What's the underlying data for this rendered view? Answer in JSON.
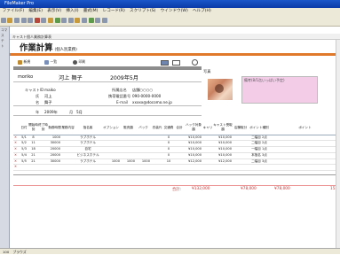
{
  "window": {
    "title": "FileMaker Pro"
  },
  "menu": [
    "ファイル(F)",
    "編集(E)",
    "表示(V)",
    "挿入(I)",
    "書式(M)",
    "レコード(R)",
    "スクリプト(S)",
    "ウインドウ(W)",
    "ヘルプ(H)"
  ],
  "sidebar": {
    "labels": [
      "コマ",
      "ス",
      "テ",
      "ト"
    ]
  },
  "breadcrumb": "キャスト個人業務計算表",
  "page": {
    "title": "作業計算",
    "subtitle": "(個人別業務)"
  },
  "nav": {
    "new": "新規",
    "list": "一覧",
    "print": "印刷"
  },
  "person": {
    "romaji": "moriko",
    "name": "河上 舞子",
    "period": "2009年5月"
  },
  "info": {
    "cast_label": "キャストID",
    "cast_value": "maiko",
    "owner_label": "所属店名",
    "owner_value": "店舗○○○○",
    "name_label": "氏",
    "name_value": "河上",
    "phone_label": "携帯電話番号",
    "phone_value": "090-0000-0000",
    "given_label": "名",
    "given_value": "舞子",
    "email_label": "E-mail",
    "email_value": "xxxxx@docomo.ne.jp",
    "year_label": "年",
    "year_value": "2009年",
    "month_label": "月",
    "month_value": "5月"
  },
  "photo_label": "写真",
  "memo": "備考(8/1迄いっぱい予定)",
  "table": {
    "headers": [
      "日付",
      "開始時刻",
      "終了時刻",
      "勤務時間",
      "業務内容",
      "指名客",
      "オプション",
      "販売額",
      "バック",
      "衣装代",
      "交通費",
      "合計",
      "ハック対象額",
      "キャリ",
      "キャスト受取額",
      "店舗取分",
      "ポイント種別",
      "ポイント"
    ],
    "rows": [
      [
        "5/1",
        "8",
        "",
        "1000",
        "",
        "ラブホテル",
        "",
        "",
        "",
        "",
        "0",
        "",
        "¥10,000",
        "",
        "¥10,000",
        "",
        "二幅目 2点",
        ""
      ],
      [
        "5/2",
        "11",
        "",
        "30000",
        "",
        "ラブホテル",
        "",
        "",
        "",
        "",
        "0",
        "",
        "¥10,000",
        "",
        "¥10,000",
        "",
        "二幅目 2点",
        ""
      ],
      [
        "5/3",
        "18",
        "",
        "20000",
        "",
        "自宅",
        "",
        "",
        "",
        "",
        "0",
        "",
        "¥10,000",
        "",
        "¥10,000",
        "",
        "一幅目 1点",
        ""
      ],
      [
        "5/4",
        "21",
        "",
        "20000",
        "",
        "ビジネスホテル",
        "",
        "",
        "",
        "",
        "0",
        "",
        "¥10,000",
        "",
        "¥10,000",
        "",
        "本指名 3点",
        ""
      ],
      [
        "5/5",
        "21",
        "",
        "30000",
        "",
        "ラブホテル",
        "1000",
        "1000",
        "1000",
        "",
        "10",
        "",
        "¥12,000",
        "",
        "¥12,000",
        "",
        "二幅目 3点",
        ""
      ],
      [
        "",
        "",
        "",
        "",
        "",
        "",
        "",
        "",
        "",
        "",
        "",
        "",
        "",
        "",
        "",
        "",
        "",
        ""
      ]
    ]
  },
  "totals": {
    "label": "合計:",
    "sum1": "¥132,000",
    "sum2": "¥78,000",
    "sum3": "¥78,000",
    "count": "15"
  },
  "status": [
    "100",
    "ブラウズ"
  ]
}
